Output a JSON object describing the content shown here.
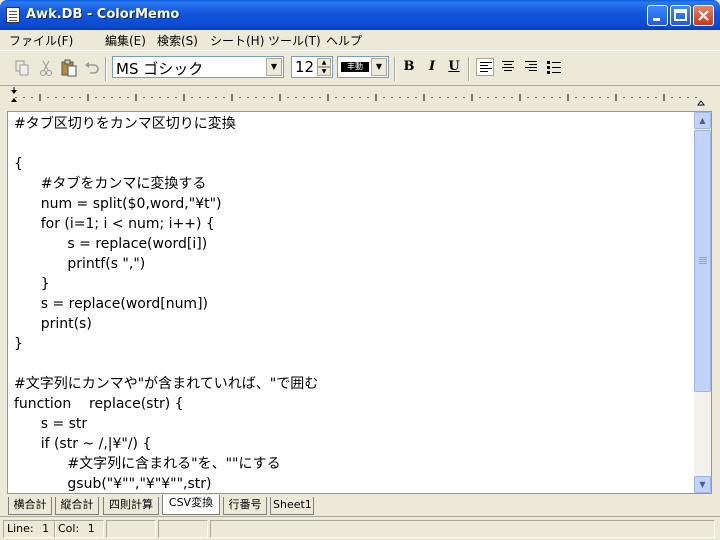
{
  "window": {
    "title": "Awk.DB - ColorMemo",
    "min_label": "_",
    "max_label": "□",
    "close_label": "✕"
  },
  "menu": [
    "ファイル(F)",
    "編集(E)",
    "検索(S)",
    "シート(H)",
    "ツール(T)",
    "ヘルプ"
  ],
  "toolbar": {
    "font_name": "MS ゴシック",
    "font_size": "12",
    "line_style_label": "丰動",
    "bold_label": "B",
    "italic_label": "I",
    "underline_label": "U",
    "icons": [
      "copy-icon",
      "cut-icon",
      "paste-icon",
      "undo-icon"
    ]
  },
  "editor": {
    "lines": [
      "#タブ区切りをカンマ区切りに変換",
      "",
      "{",
      "      #タブをカンマに変換する",
      "      num = split($0,word,\"¥t\")",
      "      for (i=1; i < num; i++) {",
      "            s = replace(word[i])",
      "            printf(s \",\")",
      "      }",
      "      s = replace(word[num])",
      "      print(s)",
      "}",
      "",
      "#文字列にカンマや\"が含まれていれば、\"で囲む",
      "function    replace(str) {",
      "      s = str",
      "      if (str ~ /,|¥\"/) {",
      "            #文字列に含まれる\"を、\"\"にする",
      "            gsub(\"¥\"\",\"¥\"¥\"\",str)"
    ]
  },
  "sheets": [
    {
      "label": "横合計",
      "active": false
    },
    {
      "label": "縦合計",
      "active": false
    },
    {
      "label": "四則計算",
      "active": false
    },
    {
      "label": "CSV変換",
      "active": true
    },
    {
      "label": "行番号",
      "active": false
    },
    {
      "label": "Sheet1",
      "active": false
    }
  ],
  "status": {
    "line_label": "Line:",
    "line_value": "1",
    "col_label": "Col:",
    "col_value": "1"
  }
}
